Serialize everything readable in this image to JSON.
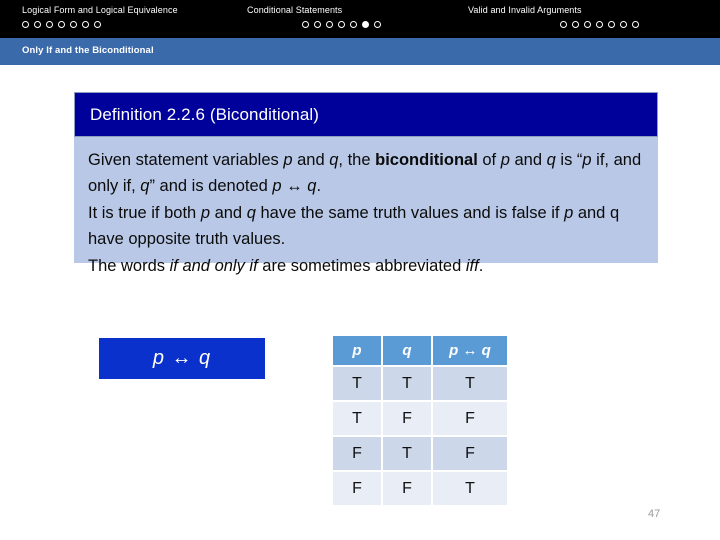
{
  "topnav": {
    "groups": [
      {
        "title": "Logical Form and Logical Equivalence",
        "dots": 7,
        "active": -1
      },
      {
        "title": "Conditional Statements",
        "dots": 7,
        "active": 5
      },
      {
        "title": "Valid and Invalid Arguments",
        "dots": 7,
        "active": -1
      }
    ]
  },
  "section": {
    "title": "Only If and the Biconditional",
    "band_color": "#3b6aaa"
  },
  "definition": {
    "header": "Definition 2.2.6 (Biconditional)",
    "header_color": "#00009b",
    "body_color": "#b8c8e6",
    "paragraphs": [
      "Given statement variables p and q, the biconditional of p and q is “p if, and only if, q” and is denoted p ↔ q.",
      "It is true if both p and q have the same truth values and is false if p and q have opposite truth values.",
      "The words if and only if are sometimes abbreviated iff."
    ]
  },
  "formula": {
    "text": "p ↔ q",
    "box_color": "#0a31cb"
  },
  "chart_data": {
    "type": "table",
    "title": "Biconditional truth table",
    "headers": [
      "p",
      "q",
      "p ↔ q"
    ],
    "rows": [
      [
        "T",
        "T",
        "T"
      ],
      [
        "T",
        "F",
        "F"
      ],
      [
        "F",
        "T",
        "F"
      ],
      [
        "F",
        "F",
        "T"
      ]
    ],
    "header_color": "#5b9bd5",
    "row_colors": [
      "#ccd8ea",
      "#e8edf6"
    ]
  },
  "footer": {
    "page_number": "47"
  }
}
